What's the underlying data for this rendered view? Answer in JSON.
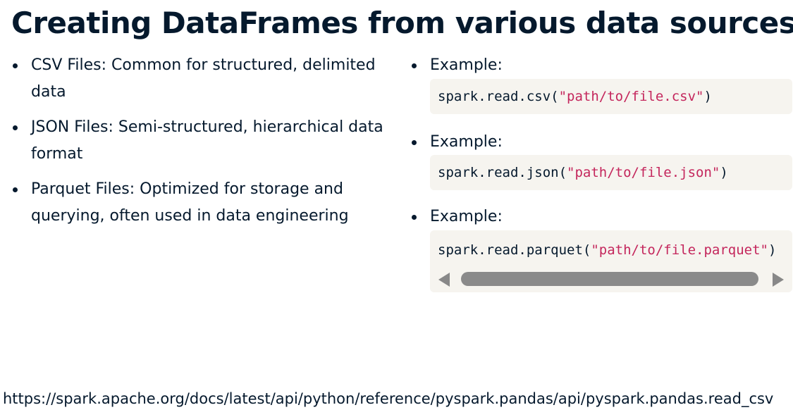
{
  "slide": {
    "title": "Creating DataFrames from various data sources",
    "bullets": [
      {
        "label": "CSV Files: Common for structured, delimited data"
      },
      {
        "label": "JSON Files: Semi-structured, hierarchical data format"
      },
      {
        "label": "Parquet Files: Optimized for storage and querying, often used in data engineering"
      }
    ],
    "examples": [
      {
        "label": "Example:",
        "code_prefix": "spark.read.csv(",
        "code_string": "\"path/to/file.csv\"",
        "code_suffix": ")"
      },
      {
        "label": "Example:",
        "code_prefix": "spark.read.json(",
        "code_string": "\"path/to/file.json\"",
        "code_suffix": ")"
      },
      {
        "label": "Example:",
        "code_prefix": "spark.read.parquet(",
        "code_string": "\"path/to/file.parquet\"",
        "code_suffix": ")"
      }
    ],
    "source_url": "https://spark.apache.org/docs/latest/api/python/reference/pyspark.pandas/api/pyspark.pandas.read_csv"
  },
  "colors": {
    "text": "#05192d",
    "code_background": "#f6f4ef",
    "string_literal": "#c4265c",
    "scrollbar": "#888888"
  }
}
